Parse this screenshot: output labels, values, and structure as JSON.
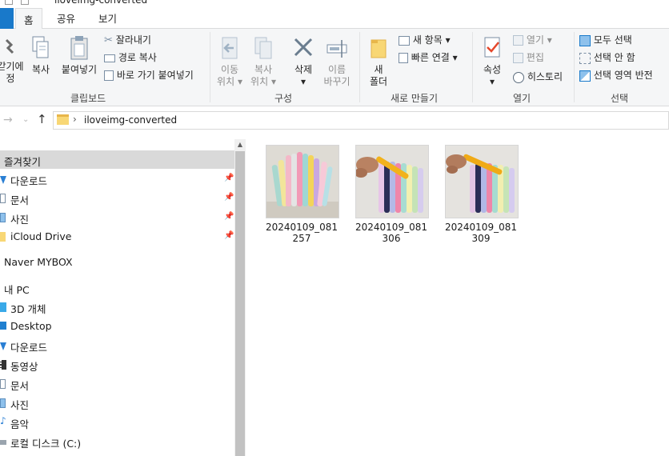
{
  "window": {
    "title": "iloveimg-converted"
  },
  "tabs": [
    {
      "label": "홈",
      "active": true
    },
    {
      "label": "공유",
      "active": false
    },
    {
      "label": "보기",
      "active": false
    }
  ],
  "ribbon": {
    "clipboard": {
      "label": "클립보드",
      "pin_quick_access": "갇기에",
      "pin_quick_access_line2": "정",
      "copy": "복사",
      "paste": "붙여넣기",
      "cut": "잘라내기",
      "copy_path": "경로 복사",
      "paste_shortcut": "바로 가기 붙여넣기"
    },
    "organize": {
      "label": "구성",
      "move_to": "이동",
      "move_to_line2": "위치",
      "copy_to": "복사",
      "copy_to_line2": "위치",
      "delete": "삭제",
      "rename": "이름",
      "rename_line2": "바꾸기"
    },
    "new": {
      "label": "새로 만들기",
      "new_folder": "새",
      "new_folder_line2": "폴더",
      "new_item": "새 항목",
      "easy_access": "빠른 연결"
    },
    "open": {
      "label": "열기",
      "properties": "속성",
      "open": "열기",
      "edit": "편집",
      "history": "히스토리"
    },
    "select": {
      "label": "선택",
      "select_all": "모두 선택",
      "select_none": "선택 안 함",
      "invert": "선택 영역 반전"
    }
  },
  "address": {
    "path": "iloveimg-converted"
  },
  "nav_pane": {
    "items": [
      {
        "label": "즐겨찾기",
        "pinned": false,
        "icon": "star-icon"
      },
      {
        "label": "다운로드",
        "pinned": true,
        "icon": "download-icon"
      },
      {
        "label": "문서",
        "pinned": true,
        "icon": "document-icon"
      },
      {
        "label": "사진",
        "pinned": true,
        "icon": "pictures-icon"
      },
      {
        "label": "iCloud Drive",
        "pinned": true,
        "icon": "folder-icon"
      },
      {
        "label": "Naver MYBOX",
        "pinned": false,
        "icon": "cloud-icon"
      },
      {
        "label": "내 PC",
        "pinned": false,
        "icon": "pc-icon"
      },
      {
        "label": "3D 개체",
        "pinned": false,
        "icon": "cube-icon"
      },
      {
        "label": "Desktop",
        "pinned": false,
        "icon": "desktop-icon"
      },
      {
        "label": "다운로드",
        "pinned": false,
        "icon": "download-icon"
      },
      {
        "label": "동영상",
        "pinned": false,
        "icon": "video-icon"
      },
      {
        "label": "문서",
        "pinned": false,
        "icon": "document-icon"
      },
      {
        "label": "사진",
        "pinned": false,
        "icon": "pictures-icon"
      },
      {
        "label": "음악",
        "pinned": false,
        "icon": "music-icon"
      },
      {
        "label": "로컬 디스크 (C:)",
        "pinned": false,
        "icon": "drive-icon"
      }
    ]
  },
  "files": [
    {
      "name": "20240109_081257"
    },
    {
      "name": "20240109_081306"
    },
    {
      "name": "20240109_081309"
    }
  ],
  "colors": {
    "accent": "#1979ca",
    "folder": "#f8d775",
    "selection": "#d9d9d9"
  }
}
